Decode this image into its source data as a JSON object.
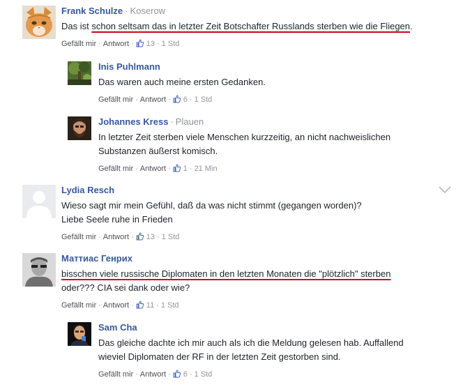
{
  "comments": [
    {
      "author": "Frank Schulze",
      "location": "Koserow",
      "text_pre": "Das ist ",
      "text_hl": "schon seltsam das in letzter Zeit Botschafter Russlands sterben wie die Fliegen",
      "text_post": ".",
      "like_label": "Gefällt mir",
      "reply_label": "Antwort",
      "likes": "13",
      "time": "1 Std"
    },
    {
      "author": "Inis Puhlmann",
      "text": "Das waren auch meine ersten Gedanken.",
      "like_label": "Gefällt mir",
      "reply_label": "Antwort",
      "likes": "6",
      "time": "1 Std"
    },
    {
      "author": "Johannes Kress",
      "location": "Plauen",
      "text_line1": "In letzter Zeit sterben viele Menschen kurzzeitig, an nicht nachweislichen",
      "text_line2": "Substanzen äußerst komisch.",
      "like_label": "Gefällt mir",
      "reply_label": "Antwort",
      "likes": "1",
      "time": "21 Min"
    },
    {
      "author": "Lydia Resch",
      "text_line1": "Wieso sagt mir mein Gefühl, daß da was nicht stimmt (gegangen worden)?",
      "text_line2": "Liebe Seele ruhe in Frieden",
      "like_label": "Gefällt mir",
      "reply_label": "Antwort",
      "likes": "13",
      "time": "1 Std"
    },
    {
      "author": "Маттиас Генрих",
      "text_hl": "bisschen viele russische Diplomaten in den letzten Monaten die \"plötzlich\" sterben ",
      "text_line2": "oder??? CIA sei dank oder wie?",
      "like_label": "Gefällt mir",
      "reply_label": "Antwort",
      "likes": "11",
      "time": "1 Std"
    },
    {
      "author": "Sam Cha",
      "text_line1": "Das gleiche dachte ich mir auch als ich die Meldung gelesen hab. Auffallend",
      "text_line2": "wieviel Diplomaten der RF in der letzten Zeit gestorben sind.",
      "like_label": "Gefällt mir",
      "reply_label": "Antwort",
      "likes": "6",
      "time": "1 Std"
    }
  ],
  "colors": {
    "author": "#365899",
    "meta": "#90949c",
    "underline": "#d0021b"
  }
}
